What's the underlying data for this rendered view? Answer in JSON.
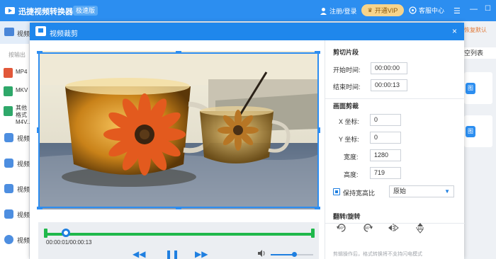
{
  "app": {
    "title": "迅捷视频转换器",
    "badge": "极速版",
    "login_label": "注册/登录",
    "vip_label": "开通VIP",
    "service_label": "客服中心"
  },
  "sidebar": {
    "top_label": "视频",
    "output_label": "按输出",
    "formats": [
      {
        "label": "MP4",
        "color": "#e2583a"
      },
      {
        "label": "MKV",
        "color": "#2fa86a"
      },
      {
        "label": "其他格式 M4V...",
        "color": "#2fa86a"
      }
    ],
    "items": [
      "视频",
      "视频",
      "视频",
      "视频",
      "视频"
    ]
  },
  "right_strip": {
    "restore_link": "恢复默认",
    "clear_label": "空列表",
    "btn_label": "图"
  },
  "dialog": {
    "title": "视频裁剪",
    "close": "×"
  },
  "player": {
    "time_text": "00:00:01/00:00:13",
    "progress": 0.077,
    "volume": 0.55
  },
  "panel": {
    "clip_title": "剪切片段",
    "start_label": "开始时间:",
    "start_value": "00:00:00",
    "end_label": "结束时间:",
    "end_value": "00:00:13",
    "crop_title": "画面剪裁",
    "x_label": "X 坐标:",
    "x_value": "0",
    "y_label": "Y 坐标:",
    "y_value": "0",
    "width_label": "宽度:",
    "width_value": "1280",
    "height_label": "高度:",
    "height_value": "719",
    "keep_ratio_label": "保持宽高比",
    "ratio_value": "原始",
    "flip_title": "翻转/旋转",
    "rotate_left": "90°",
    "rotate_right": "90°",
    "note": "剪辑操作后，格式转换将不支持闪电模式"
  },
  "colors": {
    "brand": "#2c8ef0",
    "dialog_header": "#1f87ec",
    "track": "#1fb84b",
    "accent": "#1f7fe0"
  }
}
